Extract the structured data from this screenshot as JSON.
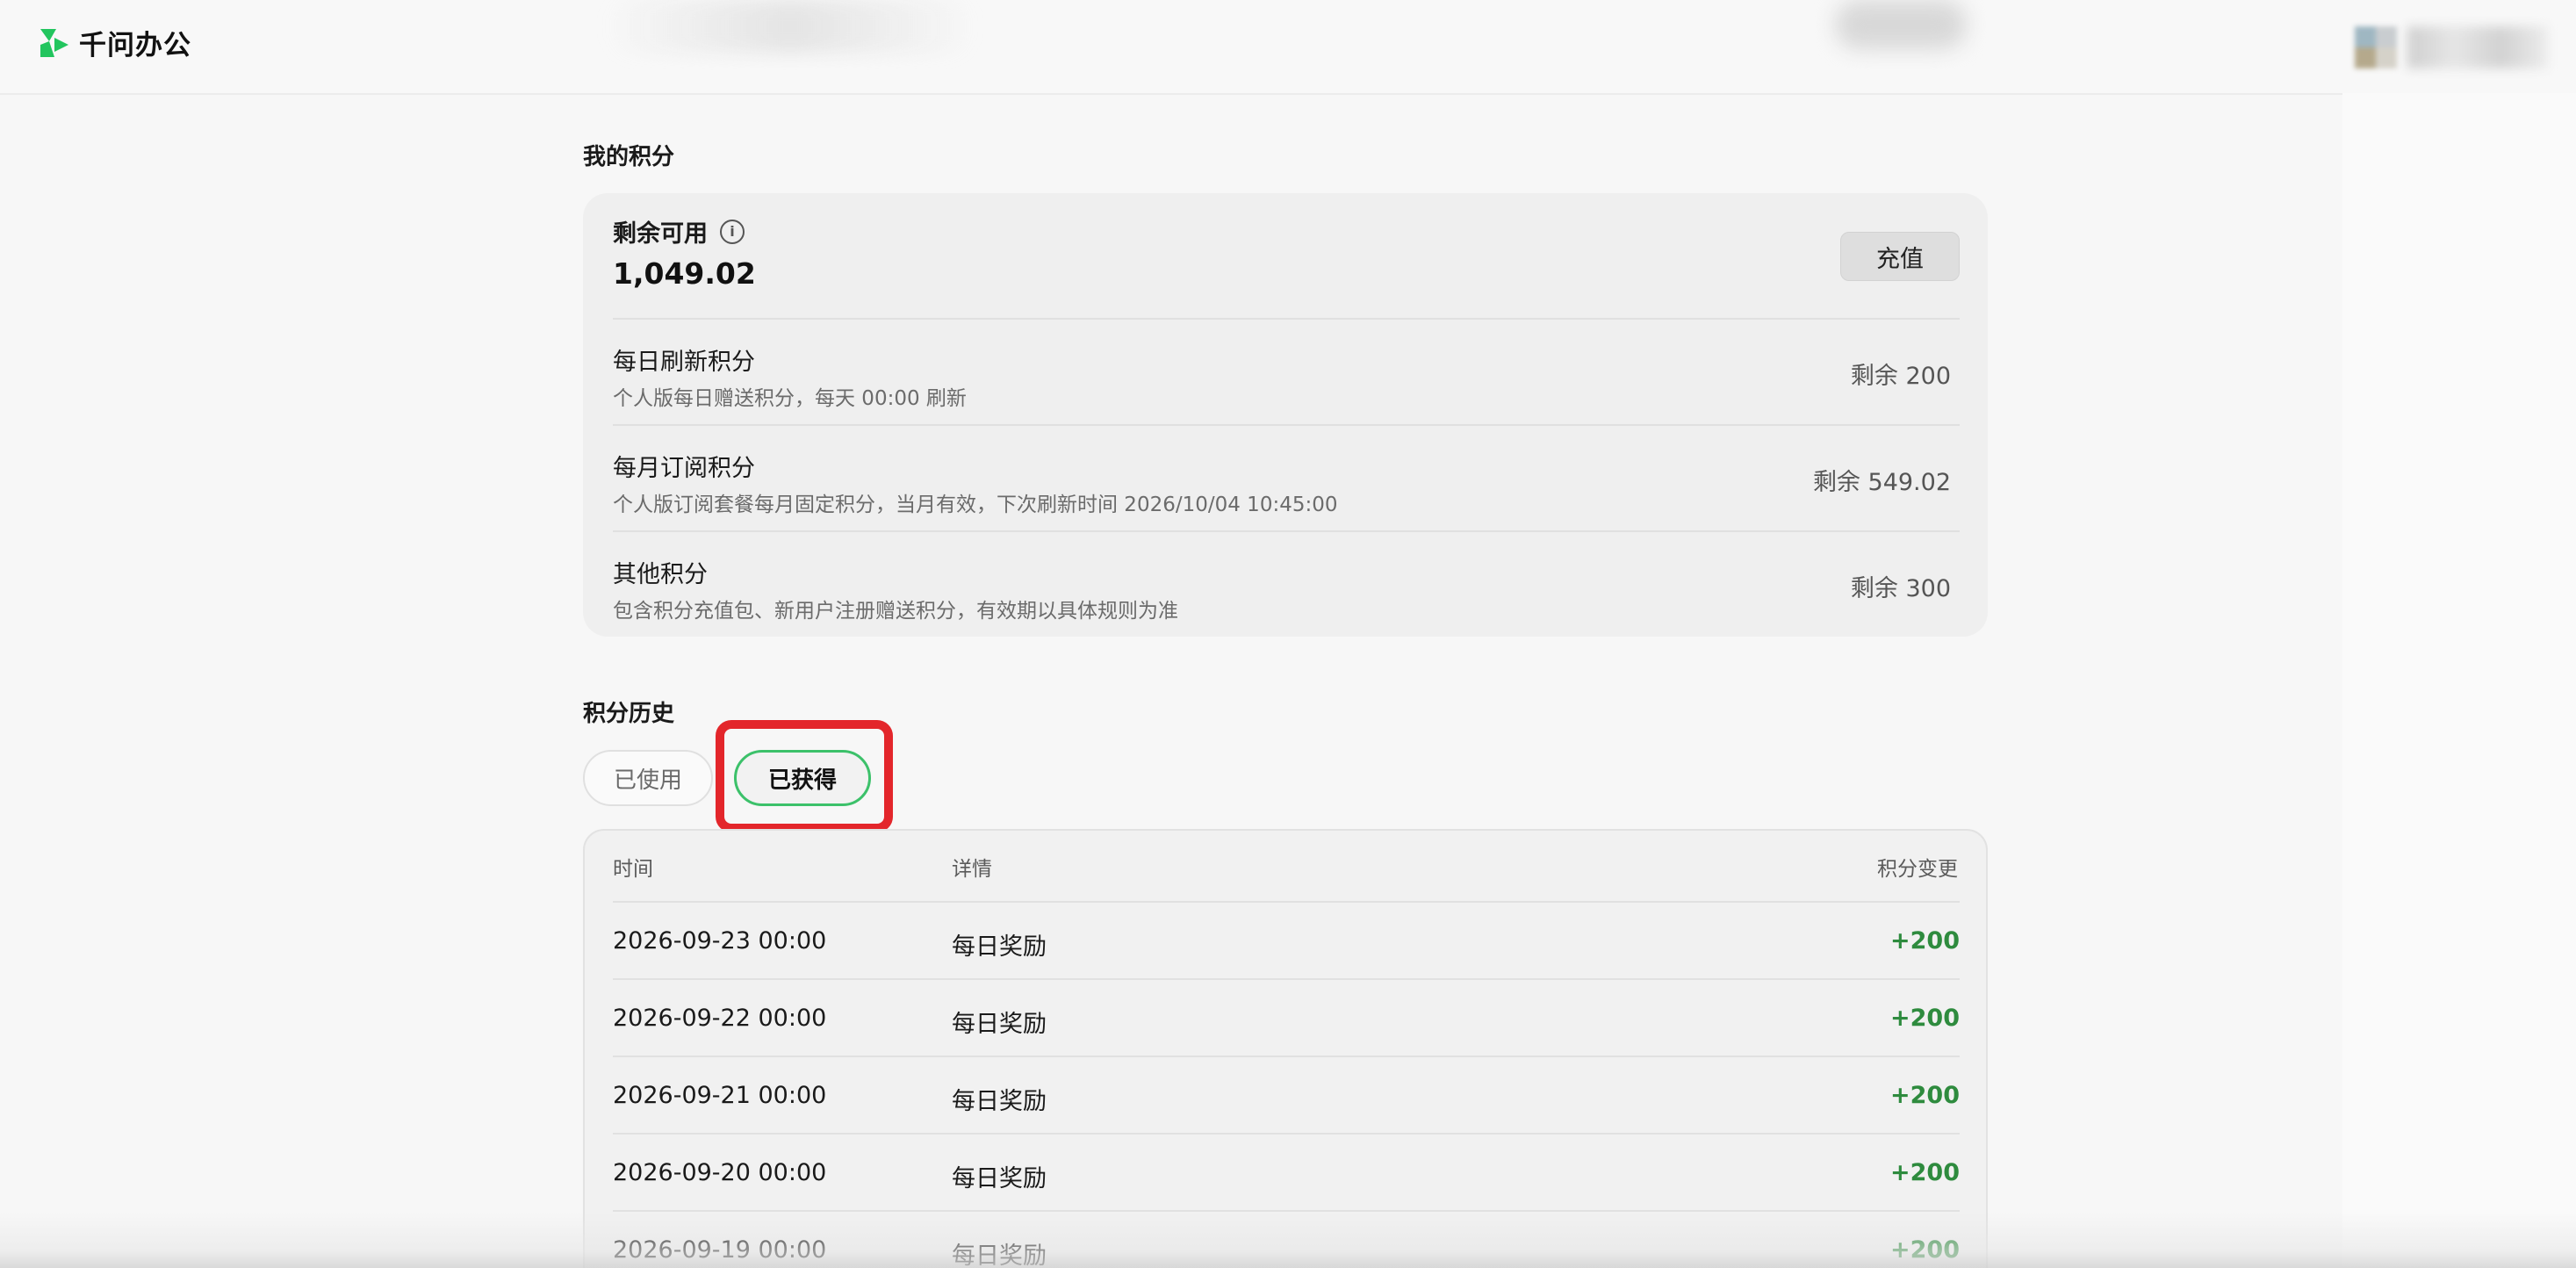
{
  "header": {
    "app_name": "千问办公",
    "logo_color": "#22c55e"
  },
  "points": {
    "section_title": "我的积分",
    "remaining_label": "剩余可用",
    "remaining_value": "1,049.02",
    "recharge_label": "充值",
    "rows": [
      {
        "title": "每日刷新积分",
        "desc": "个人版每日赠送积分，每天 00:00 刷新",
        "remaining": "剩余 200"
      },
      {
        "title": "每月订阅积分",
        "desc": "个人版订阅套餐每月固定积分，当月有效，下次刷新时间 2026/10/04 10:45:00",
        "remaining": "剩余 549.02"
      },
      {
        "title": "其他积分",
        "desc": "包含积分充值包、新用户注册赠送积分，有效期以具体规则为准",
        "remaining": "剩余 300"
      }
    ]
  },
  "history": {
    "section_title": "积分历史",
    "tabs": [
      {
        "label": "已使用",
        "active": false
      },
      {
        "label": "已获得",
        "active": true
      }
    ],
    "columns": {
      "time": "时间",
      "detail": "详情",
      "change": "积分变更"
    },
    "rows": [
      {
        "time": "2026-09-23 00:00",
        "detail": "每日奖励",
        "change": "+200"
      },
      {
        "time": "2026-09-22 00:00",
        "detail": "每日奖励",
        "change": "+200"
      },
      {
        "time": "2026-09-21 00:00",
        "detail": "每日奖励",
        "change": "+200"
      },
      {
        "time": "2026-09-20 00:00",
        "detail": "每日奖励",
        "change": "+200"
      },
      {
        "time": "2026-09-19 00:00",
        "detail": "每日奖励",
        "change": "+200"
      }
    ],
    "positive_color": "#2e8b3e",
    "highlight_color": "#e3262b"
  }
}
